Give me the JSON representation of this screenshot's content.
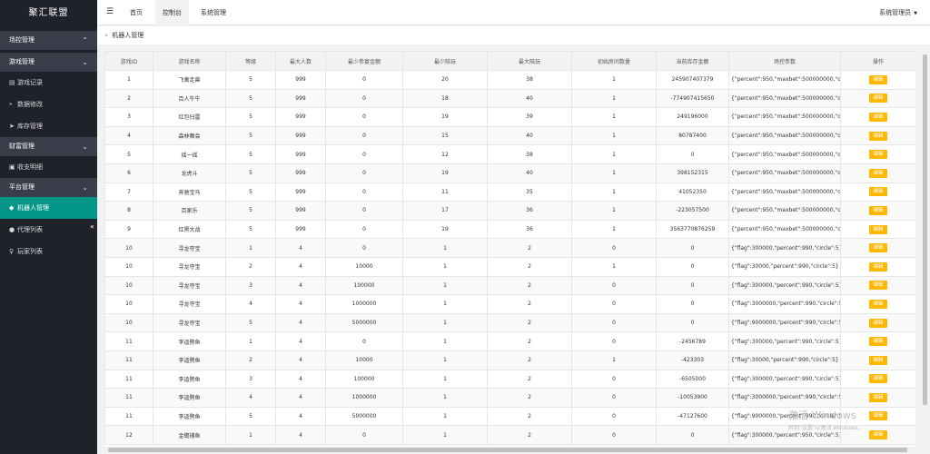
{
  "app": {
    "title": "聚汇联盟"
  },
  "sidebar": {
    "groups": [
      {
        "label": "场控管理",
        "items": []
      },
      {
        "label": "游戏管理",
        "items": [
          {
            "label": "游戏记录",
            "icon": "list-icon"
          },
          {
            "label": "数据修改",
            "icon": "data-icon"
          },
          {
            "label": "库存管理",
            "icon": "send-icon"
          }
        ]
      },
      {
        "label": "财富管理",
        "items": [
          {
            "label": "收支明细",
            "icon": "receipt-icon"
          }
        ]
      },
      {
        "label": "平台管理",
        "items": [
          {
            "label": "机器人管理",
            "icon": "diamond-icon",
            "active": true
          },
          {
            "label": "代理列表",
            "icon": "person-icon"
          },
          {
            "label": "玩家列表",
            "icon": "user-icon"
          }
        ]
      }
    ]
  },
  "header": {
    "tabs": [
      "首页",
      "控制台",
      "系统管理"
    ],
    "active_tab": "控制台",
    "user": "系统管理员"
  },
  "breadcrumb": {
    "label": "机器人管理"
  },
  "table": {
    "columns": [
      "游戏ID",
      "游戏名称",
      "等级",
      "最大人数",
      "最少参宴金额",
      "最少陪玩",
      "最大陪玩",
      "初始房间数量",
      "当前库存金额",
      "场控参数",
      "操作"
    ],
    "edit_label": "编辑",
    "rows": [
      [
        "1",
        "飞禽走兽",
        "5",
        "999",
        "0",
        "20",
        "38",
        "1",
        "245907407379",
        "{\"percent\":950,\"maxbet\":500000000,\"d..."
      ],
      [
        "2",
        "百人牛牛",
        "5",
        "999",
        "0",
        "18",
        "40",
        "1",
        "-774907415650",
        "{\"percent\":950,\"maxbet\":500000000,\"d..."
      ],
      [
        "3",
        "红包扫雷",
        "5",
        "999",
        "0",
        "19",
        "39",
        "1",
        "249196000",
        "{\"percent\":950,\"maxbet\":500000000,\"d..."
      ],
      [
        "4",
        "森林舞会",
        "5",
        "999",
        "0",
        "15",
        "40",
        "1",
        "80787400",
        "{\"percent\":950,\"maxbet\":500000000,\"d..."
      ],
      [
        "5",
        "摇一摇",
        "5",
        "999",
        "0",
        "12",
        "38",
        "1",
        "0",
        "{\"percent\":950,\"maxbet\":500000000,\"d..."
      ],
      [
        "6",
        "龙虎斗",
        "5",
        "999",
        "0",
        "19",
        "40",
        "1",
        "398152315",
        "{\"percent\":950,\"maxbet\":500000000,\"d..."
      ],
      [
        "7",
        "奔驰宝马",
        "5",
        "999",
        "0",
        "11",
        "35",
        "1",
        "41052350",
        "{\"percent\":950,\"maxbet\":500000000,\"d..."
      ],
      [
        "8",
        "百家乐",
        "5",
        "999",
        "0",
        "17",
        "36",
        "1",
        "-223057500",
        "{\"percent\":950,\"maxbet\":500000000,\"d..."
      ],
      [
        "9",
        "红黑大战",
        "5",
        "999",
        "0",
        "19",
        "36",
        "1",
        "3563770876259",
        "{\"percent\":950,\"maxbet\":500000000,\"d..."
      ],
      [
        "10",
        "寻龙夺宝",
        "1",
        "4",
        "0",
        "1",
        "2",
        "0",
        "0",
        "{\"flag\":300000,\"percent\":990,\"circle\":5}"
      ],
      [
        "10",
        "寻龙夺宝",
        "2",
        "4",
        "10000",
        "1",
        "2",
        "1",
        "0",
        "{\"flag\":30000,\"percent\":990,\"circle\":5}"
      ],
      [
        "10",
        "寻龙夺宝",
        "3",
        "4",
        "100000",
        "1",
        "2",
        "0",
        "0",
        "{\"flag\":300000,\"percent\":990,\"circle\":5}"
      ],
      [
        "10",
        "寻龙夺宝",
        "4",
        "4",
        "1000000",
        "1",
        "2",
        "0",
        "0",
        "{\"flag\":3000000,\"percent\":990,\"circle\":5}"
      ],
      [
        "10",
        "寻龙夺宝",
        "5",
        "4",
        "5000000",
        "1",
        "2",
        "0",
        "0",
        "{\"flag\":9000000,\"percent\":990,\"circle\":5}"
      ],
      [
        "11",
        "李逵劈鱼",
        "1",
        "4",
        "0",
        "1",
        "2",
        "0",
        "-2456789",
        "{\"flag\":300000,\"percent\":990,\"circle\":5}"
      ],
      [
        "11",
        "李逵劈鱼",
        "2",
        "4",
        "10000",
        "1",
        "2",
        "1",
        "-423303",
        "{\"flag\":30000,\"percent\":990,\"circle\":5}"
      ],
      [
        "11",
        "李逵劈鱼",
        "3",
        "4",
        "100000",
        "1",
        "2",
        "0",
        "-6505000",
        "{\"flag\":300000,\"percent\":990,\"circle\":5}"
      ],
      [
        "11",
        "李逵劈鱼",
        "4",
        "4",
        "1000000",
        "1",
        "2",
        "0",
        "-10053900",
        "{\"flag\":3000000,\"percent\":990,\"circle\":5}"
      ],
      [
        "11",
        "李逵劈鱼",
        "5",
        "4",
        "5000000",
        "1",
        "2",
        "0",
        "-47127600",
        "{\"flag\":9000000,\"percent\":990,\"circle\":5}"
      ],
      [
        "12",
        "金蟾捕鱼",
        "1",
        "4",
        "0",
        "1",
        "2",
        "0",
        "0",
        "{\"flag\":300000,\"percent\":950,\"circle\":5}"
      ]
    ]
  },
  "watermark": {
    "line1": "激活 Windows",
    "line2": "转到\"设置\"以激活 Windows。"
  },
  "colors": {
    "sidebar_bg": "#20222a",
    "active": "#009688",
    "edit_button": "#ffb800"
  }
}
